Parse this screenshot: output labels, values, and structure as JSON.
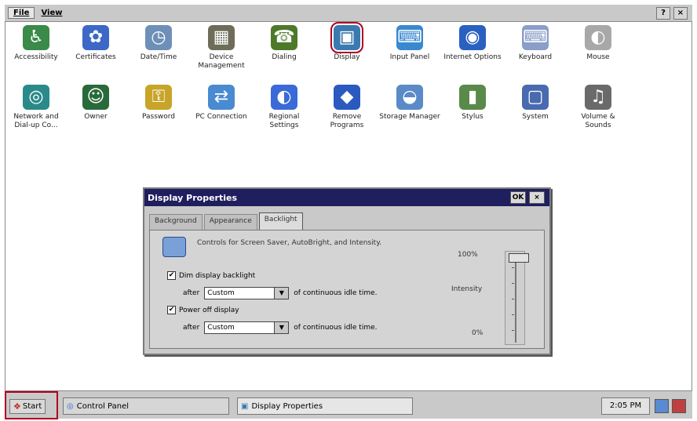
{
  "menubar": {
    "items": [
      "File",
      "View"
    ],
    "help_label": "?",
    "close_label": "×"
  },
  "icons": [
    {
      "label": "Accessibility",
      "glyph": "♿",
      "color": "#3a8a4a"
    },
    {
      "label": "Certificates",
      "glyph": "✿",
      "color": "#3d68c8"
    },
    {
      "label": "Date/Time",
      "glyph": "◷",
      "color": "#6e8fb8"
    },
    {
      "label": "Device Management",
      "glyph": "▦",
      "color": "#6d6d5a"
    },
    {
      "label": "Dialing",
      "glyph": "☎",
      "color": "#4d7a2a"
    },
    {
      "label": "Display",
      "glyph": "▣",
      "color": "#3a7ab0"
    },
    {
      "label": "Input Panel",
      "glyph": "⌨",
      "color": "#3a88d0"
    },
    {
      "label": "Internet Options",
      "glyph": "◉",
      "color": "#2a60c0"
    },
    {
      "label": "Keyboard",
      "glyph": "⌨",
      "color": "#8a9ec8"
    },
    {
      "label": "Mouse",
      "glyph": "◐",
      "color": "#a8a8a8"
    },
    {
      "label": "Network and Dial-up Co...",
      "glyph": "◎",
      "color": "#2a8a8a"
    },
    {
      "label": "Owner",
      "glyph": "☺",
      "color": "#2a6a3a"
    },
    {
      "label": "Password",
      "glyph": "⚿",
      "color": "#c8a428"
    },
    {
      "label": "PC Connection",
      "glyph": "⇄",
      "color": "#4a8ad0"
    },
    {
      "label": "Regional Settings",
      "glyph": "◐",
      "color": "#3a6ad8"
    },
    {
      "label": "Remove Programs",
      "glyph": "◆",
      "color": "#2a5ac0"
    },
    {
      "label": "Storage Manager",
      "glyph": "◒",
      "color": "#5a8ac8"
    },
    {
      "label": "Stylus",
      "glyph": "▮",
      "color": "#5a8a4a"
    },
    {
      "label": "System",
      "glyph": "▢",
      "color": "#4a6ab0"
    },
    {
      "label": "Volume & Sounds",
      "glyph": "♫",
      "color": "#6a6a6a"
    }
  ],
  "dialog": {
    "title": "Display Properties",
    "ok_label": "OK",
    "close_label": "×",
    "tabs": [
      "Background",
      "Appearance",
      "Backlight"
    ],
    "active_tab": "Backlight",
    "description": "Controls for Screen Saver, AutoBright, and Intensity.",
    "dim": {
      "checked": true,
      "check_mark": "✔",
      "label": "Dim display backlight",
      "after_label": "after",
      "value": "Custom",
      "suffix": "of continuous idle time."
    },
    "power": {
      "checked": true,
      "check_mark": "✔",
      "label": "Power off display",
      "after_label": "after",
      "value": "Custom",
      "suffix": "of continuous idle time."
    },
    "slider": {
      "max_label": "100%",
      "label": "Intensity",
      "min_label": "0%",
      "value_percent": 100
    }
  },
  "taskbar": {
    "start_label": "Start",
    "buttons": [
      "Control Panel",
      "Display Properties"
    ],
    "clock": "2:05 PM"
  }
}
